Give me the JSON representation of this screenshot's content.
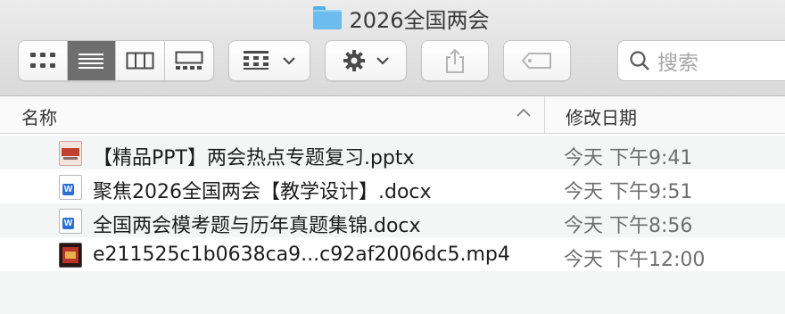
{
  "window": {
    "title": "2026全国两会"
  },
  "toolbar": {
    "view_buttons": [
      {
        "icon": "icon-view-grid",
        "active": false
      },
      {
        "icon": "list-view",
        "active": true
      },
      {
        "icon": "column-view",
        "active": false
      },
      {
        "icon": "gallery-view",
        "active": false
      }
    ],
    "search": {
      "placeholder": "搜索"
    }
  },
  "columns": {
    "name": "名称",
    "date_modified": "修改日期"
  },
  "files": [
    {
      "name": "【精品PPT】两会热点专题复习.pptx",
      "date": "今天 下午9:41",
      "icon": "pptx-file"
    },
    {
      "name": "聚焦2026全国两会【教学设计】.docx",
      "date": "今天 下午9:51",
      "icon": "docx-file"
    },
    {
      "name": "全国两会模考题与历年真题集锦.docx",
      "date": "今天 下午8:56",
      "icon": "docx-file"
    },
    {
      "name": "e211525c1b0638ca9...c92af2006dc5.mp4",
      "date": "今天 下午12:00",
      "icon": "mp4-file"
    }
  ]
}
